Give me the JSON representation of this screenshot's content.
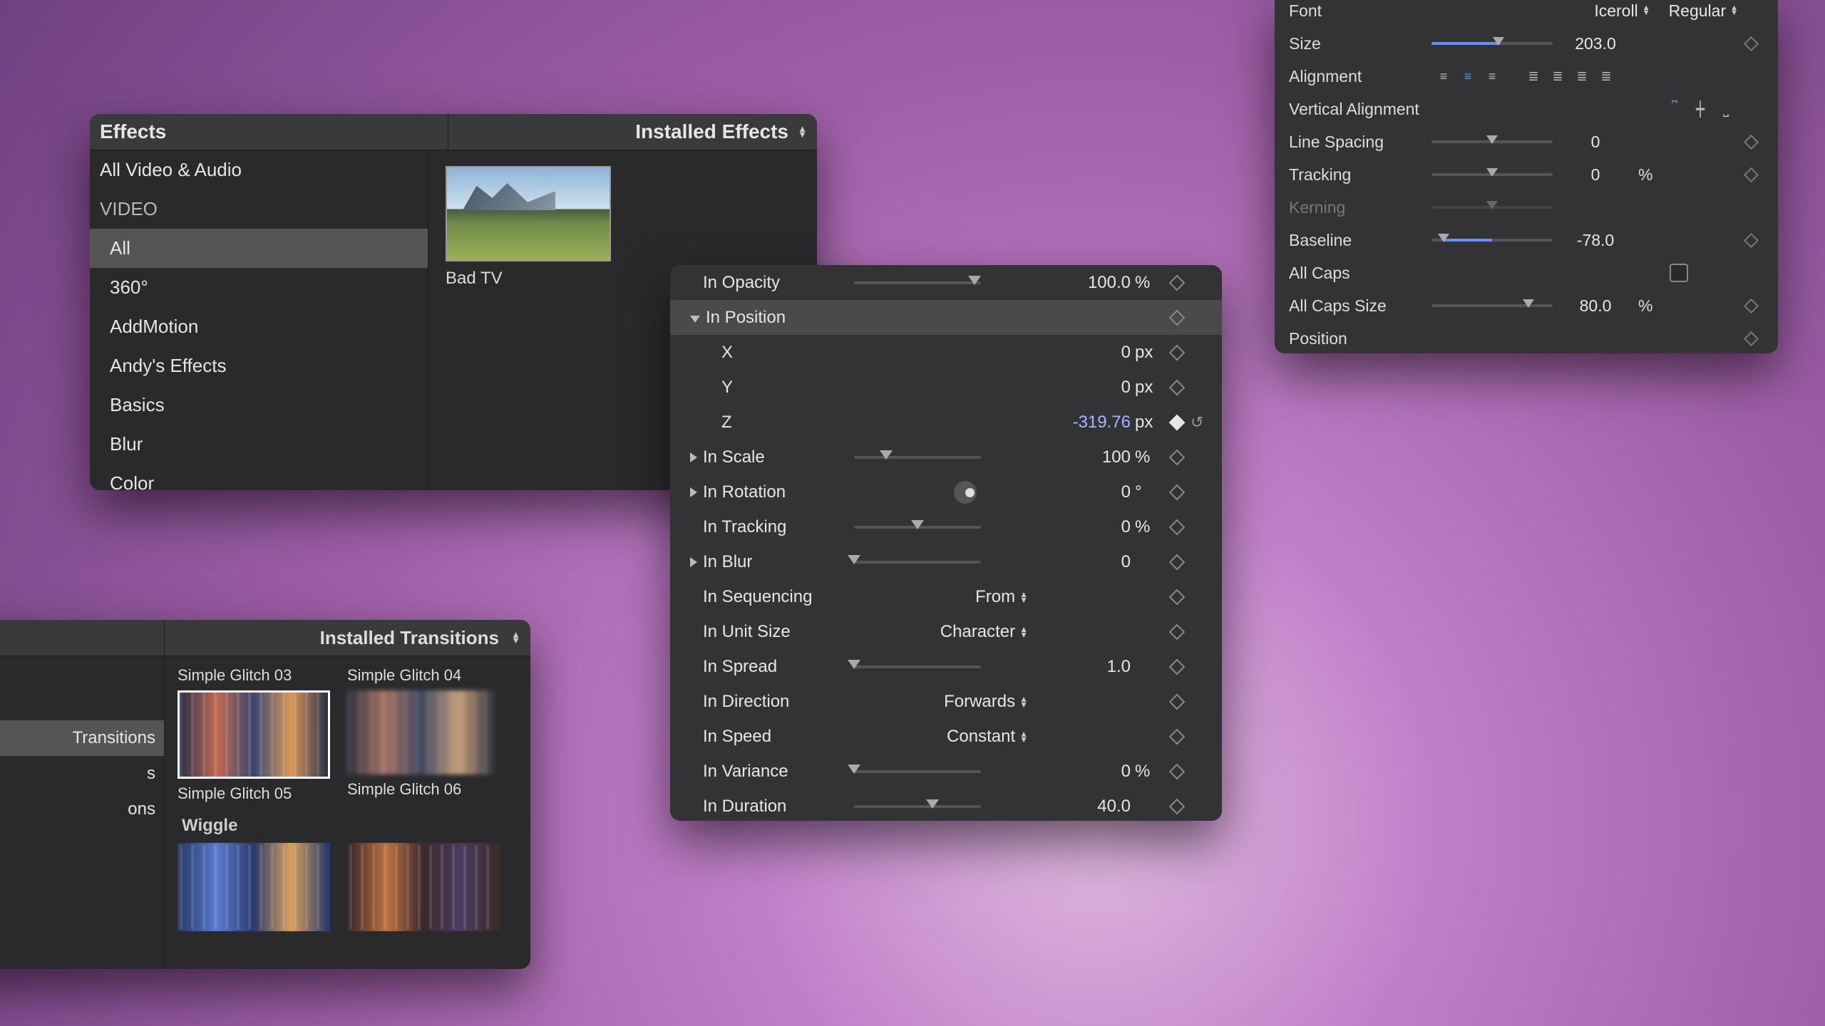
{
  "effects": {
    "title": "Effects",
    "mode_label": "Installed Effects",
    "sidebar": [
      {
        "label": "All Video & Audio",
        "selected": false,
        "sub": false,
        "cat": false
      },
      {
        "label": "VIDEO",
        "selected": false,
        "sub": false,
        "cat": true
      },
      {
        "label": "All",
        "selected": true,
        "sub": true,
        "cat": false
      },
      {
        "label": "360°",
        "selected": false,
        "sub": true,
        "cat": false
      },
      {
        "label": "AddMotion",
        "selected": false,
        "sub": true,
        "cat": false
      },
      {
        "label": "Andy's Effects",
        "selected": false,
        "sub": true,
        "cat": false
      },
      {
        "label": "Basics",
        "selected": false,
        "sub": true,
        "cat": false
      },
      {
        "label": "Blur",
        "selected": false,
        "sub": true,
        "cat": false
      },
      {
        "label": "Color",
        "selected": false,
        "sub": true,
        "cat": false
      }
    ],
    "items": [
      {
        "label": "Bad TV"
      }
    ]
  },
  "transitions": {
    "mode_label": "Installed Transitions",
    "sidebar": [
      {
        "label": "Transitions",
        "selected": true
      },
      {
        "label": "s",
        "selected": false
      },
      {
        "label": "ons",
        "selected": false
      }
    ],
    "row1": [
      {
        "label": "Simple Glitch 03"
      },
      {
        "label": "Simple Glitch 04"
      }
    ],
    "row2": [
      {
        "label": "Simple Glitch 05",
        "selected": true
      },
      {
        "label": "Simple Glitch 06",
        "selected": false
      }
    ],
    "group_name": "Wiggle"
  },
  "props": {
    "rows": [
      {
        "label": "In Opacity",
        "type": "slider",
        "pos": 0.95,
        "value": "100.0",
        "unit": "%"
      },
      {
        "label": "In Position",
        "type": "disclose",
        "open": true,
        "selected": true
      },
      {
        "label": "X",
        "sub": true,
        "type": "value",
        "value": "0",
        "unit": "px"
      },
      {
        "label": "Y",
        "sub": true,
        "type": "value",
        "value": "0",
        "unit": "px"
      },
      {
        "label": "Z",
        "sub": true,
        "type": "editing",
        "value": "-319.76",
        "unit": "px",
        "key_on": true,
        "reset": true
      },
      {
        "label": "In Scale",
        "type": "slider-d",
        "pos": 0.25,
        "value": "100",
        "unit": "%"
      },
      {
        "label": "In Rotation",
        "type": "dial-d",
        "value": "0",
        "unit": "°"
      },
      {
        "label": "In Tracking",
        "type": "slider",
        "pos": 0.5,
        "value": "0",
        "unit": "%"
      },
      {
        "label": "In Blur",
        "type": "slider-d",
        "pos": 0.0,
        "value": "0",
        "unit": ""
      },
      {
        "label": "In Sequencing",
        "type": "dropdown",
        "value": "From"
      },
      {
        "label": "In Unit Size",
        "type": "dropdown",
        "value": "Character"
      },
      {
        "label": "In Spread",
        "type": "slider",
        "pos": 0.0,
        "value": "1.0",
        "unit": ""
      },
      {
        "label": "In Direction",
        "type": "dropdown",
        "value": "Forwards"
      },
      {
        "label": "In Speed",
        "type": "dropdown",
        "value": "Constant"
      },
      {
        "label": "In Variance",
        "type": "slider",
        "pos": 0.0,
        "value": "0",
        "unit": "%"
      },
      {
        "label": "In Duration",
        "type": "slider",
        "pos": 0.62,
        "value": "40.0",
        "unit": ""
      }
    ]
  },
  "text": {
    "font_label": "Font",
    "font_family": "Iceroll",
    "font_style": "Regular",
    "size_label": "Size",
    "size_value": "203.0",
    "size_pos": 0.55,
    "alignment_label": "Alignment",
    "valign_label": "Vertical Alignment",
    "linespacing_label": "Line Spacing",
    "linespacing_value": "0",
    "tracking_label": "Tracking",
    "tracking_value": "0",
    "tracking_unit": "%",
    "kerning_label": "Kerning",
    "baseline_label": "Baseline",
    "baseline_value": "-78.0",
    "baseline_pos": 0.1,
    "allcaps_label": "All Caps",
    "allcaps_size_label": "All Caps Size",
    "allcaps_size_value": "80.0",
    "allcaps_size_unit": "%",
    "allcaps_size_pos": 0.8,
    "position_label": "Position"
  }
}
